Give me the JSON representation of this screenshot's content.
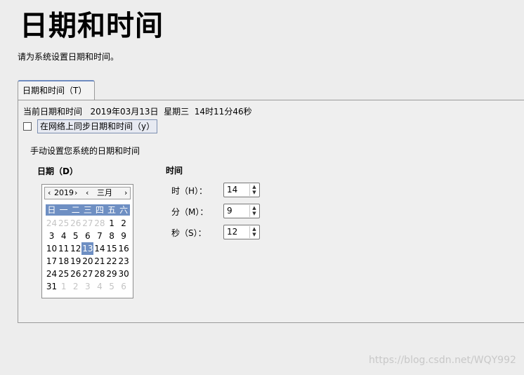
{
  "page": {
    "title": "日期和时间",
    "subtitle": "请为系统设置日期和时间。"
  },
  "tab": {
    "label": "日期和时间（T）"
  },
  "current": {
    "text": "当前日期和时间   2019年03月13日  星期三  14时11分46秒"
  },
  "sync": {
    "label": "在网络上同步日期和时间（y）",
    "checked": false
  },
  "manual": {
    "label": "手动设置您系统的日期和时间"
  },
  "date_section": {
    "heading": "日期（D）"
  },
  "calendar": {
    "year": "2019",
    "month": "三月",
    "prev_year": "‹",
    "next_year": "›",
    "prev_month": "‹",
    "next_month": "›",
    "weekdays": [
      "日",
      "一",
      "二",
      "三",
      "四",
      "五",
      "六"
    ],
    "days": [
      "24",
      "25",
      "26",
      "27",
      "28",
      "1",
      "2",
      "3",
      "4",
      "5",
      "6",
      "7",
      "8",
      "9",
      "10",
      "11",
      "12",
      "13",
      "14",
      "15",
      "16",
      "17",
      "18",
      "19",
      "20",
      "21",
      "22",
      "23",
      "24",
      "25",
      "26",
      "27",
      "28",
      "29",
      "30",
      "31",
      "1",
      "2",
      "3",
      "4",
      "5",
      "6"
    ],
    "selected": "13"
  },
  "time_section": {
    "heading": "时间",
    "hour": {
      "label": "时（H）：",
      "value": "14"
    },
    "minute": {
      "label": "分（M）：",
      "value": "9"
    },
    "second": {
      "label": "秒（S）：",
      "value": "12"
    }
  },
  "spin_up": "▲",
  "spin_down": "▼",
  "watermark": "https://blog.csdn.net/WQY992"
}
